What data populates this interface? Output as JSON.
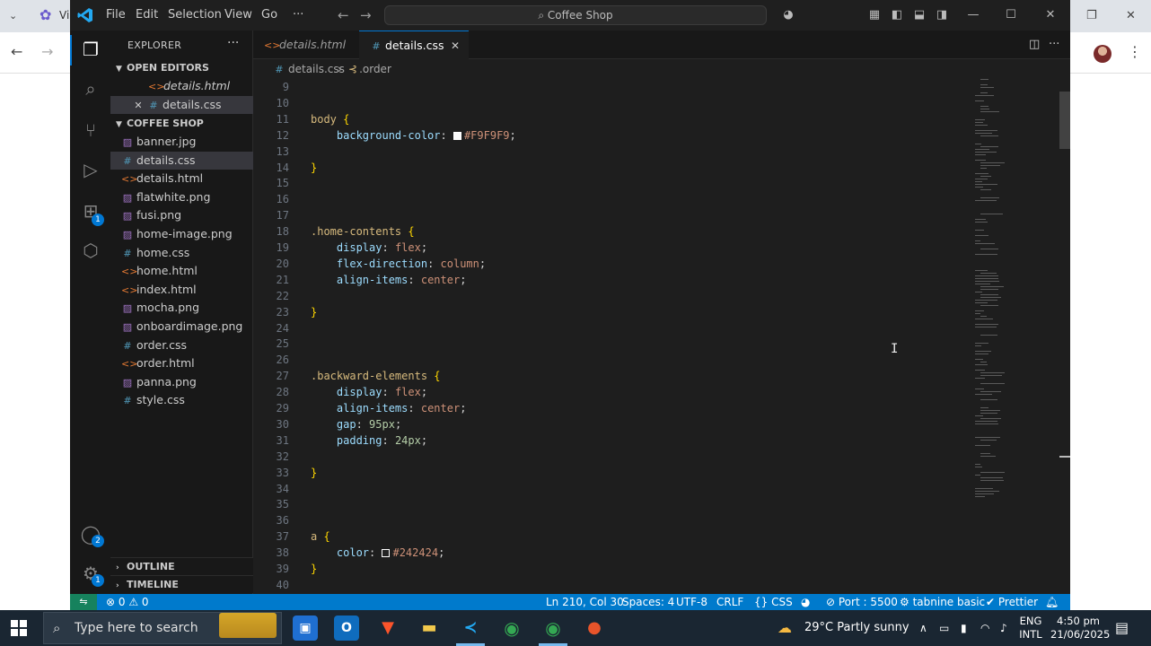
{
  "background_browser": {
    "tab_title": "Vi"
  },
  "window": {
    "menu": [
      "File",
      "Edit",
      "Selection",
      "View",
      "Go",
      "···"
    ],
    "command_center": "Coffee Shop"
  },
  "activity_badges": {
    "extensions": "1",
    "accounts": "2",
    "manage": "1"
  },
  "explorer": {
    "title": "EXPLORER",
    "open_editors_label": "OPEN EDITORS",
    "open_editors": [
      {
        "name": "details.html",
        "type": "html"
      },
      {
        "name": "details.css",
        "type": "css"
      }
    ],
    "folder_label": "COFFEE SHOP",
    "files": [
      {
        "name": "banner.jpg",
        "type": "img"
      },
      {
        "name": "details.css",
        "type": "css"
      },
      {
        "name": "details.html",
        "type": "html"
      },
      {
        "name": "flatwhite.png",
        "type": "img"
      },
      {
        "name": "fusi.png",
        "type": "img"
      },
      {
        "name": "home-image.png",
        "type": "img"
      },
      {
        "name": "home.css",
        "type": "css"
      },
      {
        "name": "home.html",
        "type": "html"
      },
      {
        "name": "index.html",
        "type": "html"
      },
      {
        "name": "mocha.png",
        "type": "img"
      },
      {
        "name": "onboardimage.png",
        "type": "img"
      },
      {
        "name": "order.css",
        "type": "css"
      },
      {
        "name": "order.html",
        "type": "html"
      },
      {
        "name": "panna.png",
        "type": "img"
      },
      {
        "name": "style.css",
        "type": "css"
      }
    ],
    "outline_label": "OUTLINE",
    "timeline_label": "TIMELINE"
  },
  "tabs": [
    {
      "name": "details.html",
      "type": "html",
      "active": false
    },
    {
      "name": "details.css",
      "type": "css",
      "active": true
    }
  ],
  "breadcrumb": {
    "file": "details.css",
    "symbol": ".order"
  },
  "editor": {
    "first_line": 9,
    "lines": [
      [],
      [],
      [
        [
          "sel",
          "body"
        ],
        [
          "p",
          " "
        ],
        [
          "b",
          "{"
        ]
      ],
      [
        [
          "p",
          "    "
        ],
        [
          "prop",
          "background-color"
        ],
        [
          "p",
          ": "
        ],
        [
          "swatch",
          "#F9F9F9"
        ],
        [
          "val",
          "#F9F9F9"
        ],
        [
          "p",
          ";"
        ]
      ],
      [],
      [
        [
          "b",
          "}"
        ]
      ],
      [],
      [],
      [],
      [
        [
          "sel",
          ".home-contents"
        ],
        [
          "p",
          " "
        ],
        [
          "b",
          "{"
        ]
      ],
      [
        [
          "p",
          "    "
        ],
        [
          "prop",
          "display"
        ],
        [
          "p",
          ": "
        ],
        [
          "val",
          "flex"
        ],
        [
          "p",
          ";"
        ]
      ],
      [
        [
          "p",
          "    "
        ],
        [
          "prop",
          "flex-direction"
        ],
        [
          "p",
          ": "
        ],
        [
          "val",
          "column"
        ],
        [
          "p",
          ";"
        ]
      ],
      [
        [
          "p",
          "    "
        ],
        [
          "prop",
          "align-items"
        ],
        [
          "p",
          ": "
        ],
        [
          "val",
          "center"
        ],
        [
          "p",
          ";"
        ]
      ],
      [],
      [
        [
          "b",
          "}"
        ]
      ],
      [],
      [],
      [],
      [
        [
          "sel",
          ".backward-elements"
        ],
        [
          "p",
          " "
        ],
        [
          "b",
          "{"
        ]
      ],
      [
        [
          "p",
          "    "
        ],
        [
          "prop",
          "display"
        ],
        [
          "p",
          ": "
        ],
        [
          "val",
          "flex"
        ],
        [
          "p",
          ";"
        ]
      ],
      [
        [
          "p",
          "    "
        ],
        [
          "prop",
          "align-items"
        ],
        [
          "p",
          ": "
        ],
        [
          "val",
          "center"
        ],
        [
          "p",
          ";"
        ]
      ],
      [
        [
          "p",
          "    "
        ],
        [
          "prop",
          "gap"
        ],
        [
          "p",
          ": "
        ],
        [
          "num",
          "95px"
        ],
        [
          "p",
          ";"
        ]
      ],
      [
        [
          "p",
          "    "
        ],
        [
          "prop",
          "padding"
        ],
        [
          "p",
          ": "
        ],
        [
          "num",
          "24px"
        ],
        [
          "p",
          ";"
        ]
      ],
      [],
      [
        [
          "b",
          "}"
        ]
      ],
      [],
      [],
      [],
      [
        [
          "sel",
          "a"
        ],
        [
          "p",
          " "
        ],
        [
          "b",
          "{"
        ]
      ],
      [
        [
          "p",
          "    "
        ],
        [
          "prop",
          "color"
        ],
        [
          "p",
          ": "
        ],
        [
          "swatch",
          "#242424"
        ],
        [
          "val",
          "#242424"
        ],
        [
          "p",
          ";"
        ]
      ],
      [
        [
          "b",
          "}"
        ]
      ],
      []
    ]
  },
  "statusbar": {
    "problems": "⊗ 0 ⚠ 0",
    "position": "Ln 210, Col 30",
    "spaces": "Spaces: 4",
    "encoding": "UTF-8",
    "eol": "CRLF",
    "language": "{} CSS",
    "port": "⊘ Port : 5500",
    "tabnine": "⚙ tabnine basic",
    "prettier": "✔ Prettier"
  },
  "taskbar": {
    "search_placeholder": "Type here to search",
    "weather": "29°C  Partly sunny",
    "language_top": "ENG",
    "language_bottom": "INTL",
    "time": "4:50 pm",
    "date": "21/06/2025"
  },
  "colors": {
    "accent": "#007acc",
    "editor_bg": "#1e1e1e",
    "sidebar_bg": "#181818"
  }
}
